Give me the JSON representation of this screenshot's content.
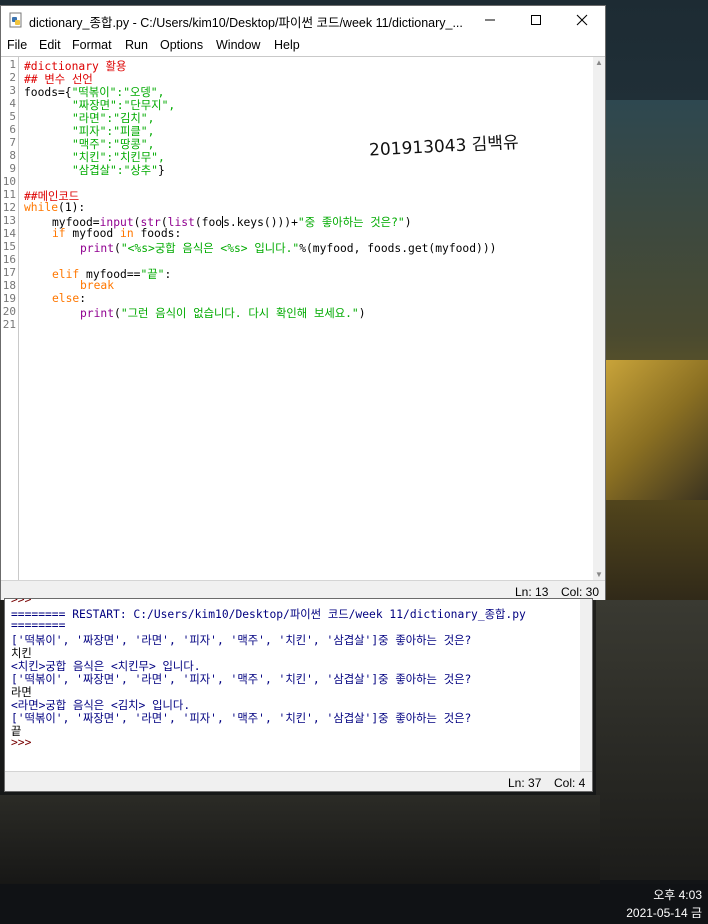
{
  "taskbar": {
    "time": "오후 4:03",
    "date": "2021-05-14 금"
  },
  "editor": {
    "title": "dictionary_종합.py - C:/Users/kim10/Desktop/파이썬 코드/week 11/dictionary_...",
    "menu": [
      "File",
      "Edit",
      "Format",
      "Run",
      "Options",
      "Window",
      "Help"
    ],
    "line_numbers": [
      "1",
      "2",
      "3",
      "4",
      "5",
      "6",
      "7",
      "8",
      "9",
      "10",
      "11",
      "12",
      "13",
      "14",
      "15",
      "16",
      "17",
      "18",
      "19",
      "20",
      "21"
    ],
    "code": {
      "l1": "#dictionary 활용",
      "l2": "## 변수 선언",
      "l3_a": "foods={",
      "l3_b": "\"떡볶이\":\"오뎅\",",
      "l4": "\"짜장면\":\"단무지\",",
      "l5": "\"라면\":\"김치\",",
      "l6": "\"피자\":\"피클\",",
      "l7": "\"맥주\":\"땅콩\",",
      "l8": "\"치킨\":\"치킨무\",",
      "l9_a": "\"삼겹살\":\"상추\"",
      "l9_b": "}",
      "l11": "##메인코드",
      "l12_kw": "while",
      "l12_rest": "(1):",
      "l13_a": "myfood=",
      "l13_b": "input",
      "l13_c": "(",
      "l13_d": "str",
      "l13_e": "(",
      "l13_f": "list",
      "l13_g": "(foo",
      "l13_h": "s.keys()))+",
      "l13_i": "\"중 좋아하는 것은?\"",
      "l13_j": ")",
      "l14_kw1": "if",
      "l14_mid": " myfood ",
      "l14_kw2": "in",
      "l14_rest": " foods:",
      "l15_a": "print",
      "l15_b": "(",
      "l15_c": "\"<%s>궁합 음식은 <%s> 입니다.\"",
      "l15_d": "%(myfood, foods.get(myfood)))",
      "l17_kw": "elif",
      "l17_mid": " myfood==",
      "l17_str": "\"끝\"",
      "l17_end": ":",
      "l18": "break",
      "l19": "else",
      "l19_end": ":",
      "l20_a": "print",
      "l20_b": "(",
      "l20_c": "\"그런 음식이 없습니다. 다시 확인해 보세요.\"",
      "l20_d": ")"
    },
    "handwriting": "201913043 김백유",
    "status_line": "Ln: 13",
    "status_col": "Col: 30"
  },
  "shell": {
    "lines": {
      "s0": ">>>",
      "s1": "======== RESTART: C:/Users/kim10/Desktop/파이썬 코드/week 11/dictionary_종합.py",
      "s2": "========",
      "s3": "['떡볶이', '짜장면', '라면', '피자', '맥주', '치킨', '삼겹살']중 좋아하는 것은?",
      "s4": "치킨",
      "s5": "<치킨>궁합 음식은 <치킨무> 입니다.",
      "s6": "['떡볶이', '짜장면', '라면', '피자', '맥주', '치킨', '삼겹살']중 좋아하는 것은?",
      "s7": "라면",
      "s8": "<라면>궁합 음식은 <김치> 입니다.",
      "s9": "['떡볶이', '짜장면', '라면', '피자', '맥주', '치킨', '삼겹살']중 좋아하는 것은?",
      "s10": "끝",
      "s11": ">>>"
    },
    "status_line": "Ln: 37",
    "status_col": "Col: 4"
  }
}
